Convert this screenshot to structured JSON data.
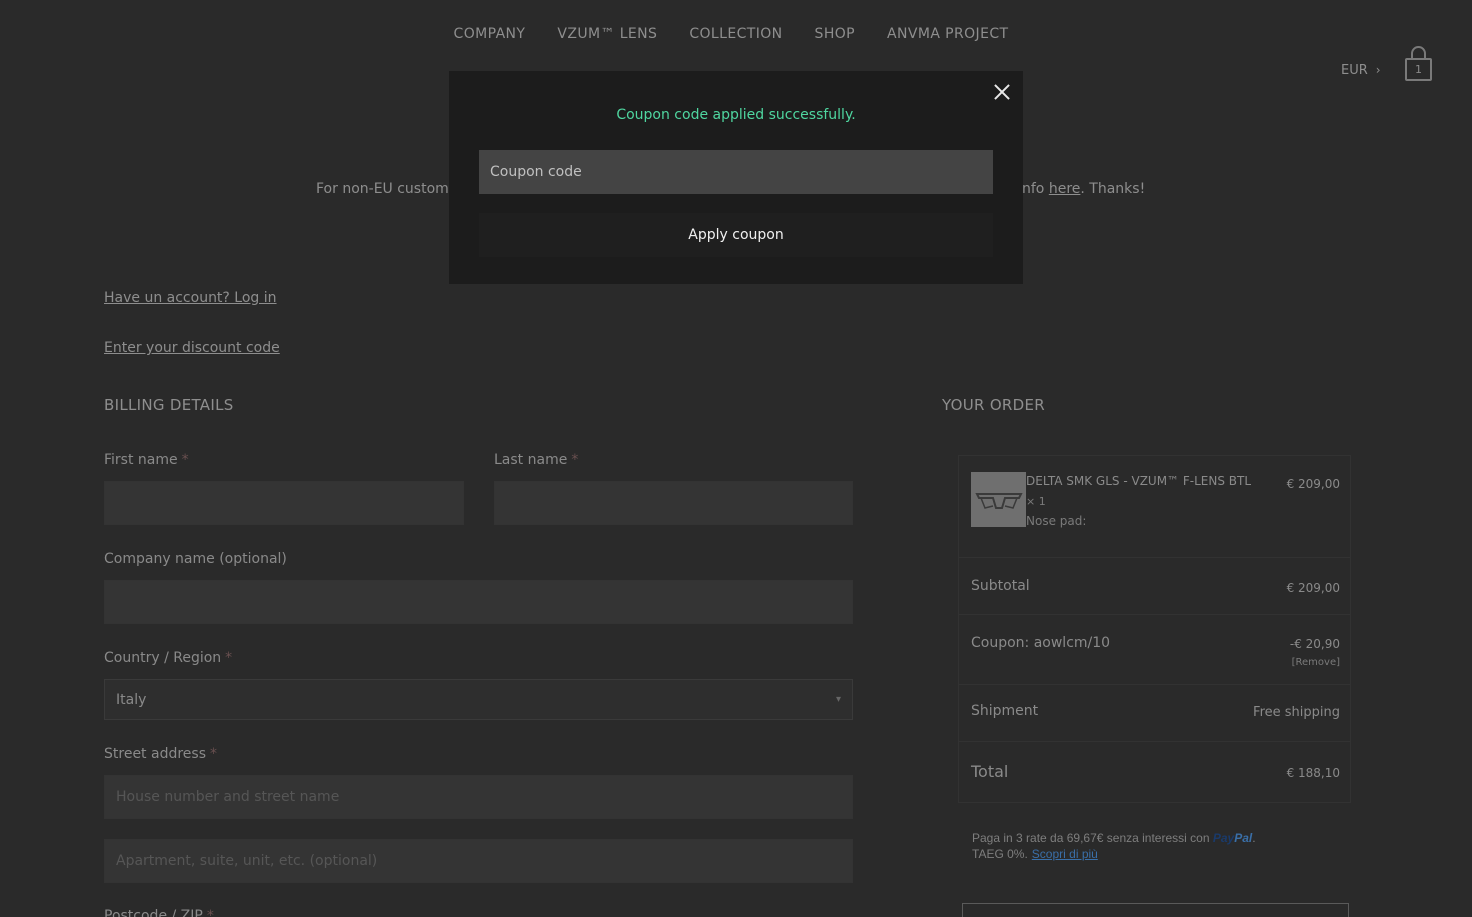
{
  "nav": {
    "items": [
      "COMPANY",
      "VZUM™ LENS",
      "COLLECTION",
      "SHOP",
      "ANVMA PROJECT"
    ]
  },
  "header": {
    "currency": "EUR",
    "currency_chevron": "›",
    "cart_count": "1",
    "cart_icon": "shopping-bag-icon"
  },
  "notice": {
    "left_text": "For non-EU custom",
    "right_prefix": "nfo ",
    "right_link": "here",
    "right_suffix": ". Thanks!"
  },
  "links": {
    "login": "Have un account? Log in",
    "discount": "Enter your discount code"
  },
  "billing": {
    "title": "BILLING DETAILS",
    "required_mark": "*",
    "first_name_label": "First name",
    "last_name_label": "Last name",
    "company_label": "Company name (optional)",
    "country_label": "Country / Region",
    "country_value": "Italy",
    "street_label": "Street address",
    "street_placeholder": "House number and street name",
    "apartment_placeholder": "Apartment, suite, unit, etc. (optional)",
    "postcode_label": "Postcode / ZIP"
  },
  "order": {
    "title": "YOUR ORDER",
    "product": {
      "name": "DELTA SMK GLS - VZUM™ F-LENS BTL",
      "qty": "× 1",
      "option": "Nose pad:",
      "price": "€ 209,00"
    },
    "subtotal_label": "Subtotal",
    "subtotal_value": "€ 209,00",
    "coupon_label": "Coupon: aowlcm/10",
    "coupon_value": "-€ 20,90",
    "coupon_remove": "[Remove]",
    "shipment_label": "Shipment",
    "shipment_value": "Free shipping",
    "total_label": "Total",
    "total_value": "€ 188,10"
  },
  "paypal": {
    "line1": "Paga in 3 rate da 69,67€ senza interessi con",
    "brand1": "Pay",
    "brand2": "Pal",
    "line1_end": ".",
    "line2": "TAEG 0%.",
    "learn_more": "Scopri di più"
  },
  "modal": {
    "success_message": "Coupon code applied successfully.",
    "coupon_placeholder": "Coupon code",
    "apply_label": "Apply coupon",
    "close_icon": "close-icon"
  },
  "colors": {
    "success": "#4fd6a0",
    "background": "#2a2a2a",
    "modal_bg": "#1c1c1c"
  }
}
